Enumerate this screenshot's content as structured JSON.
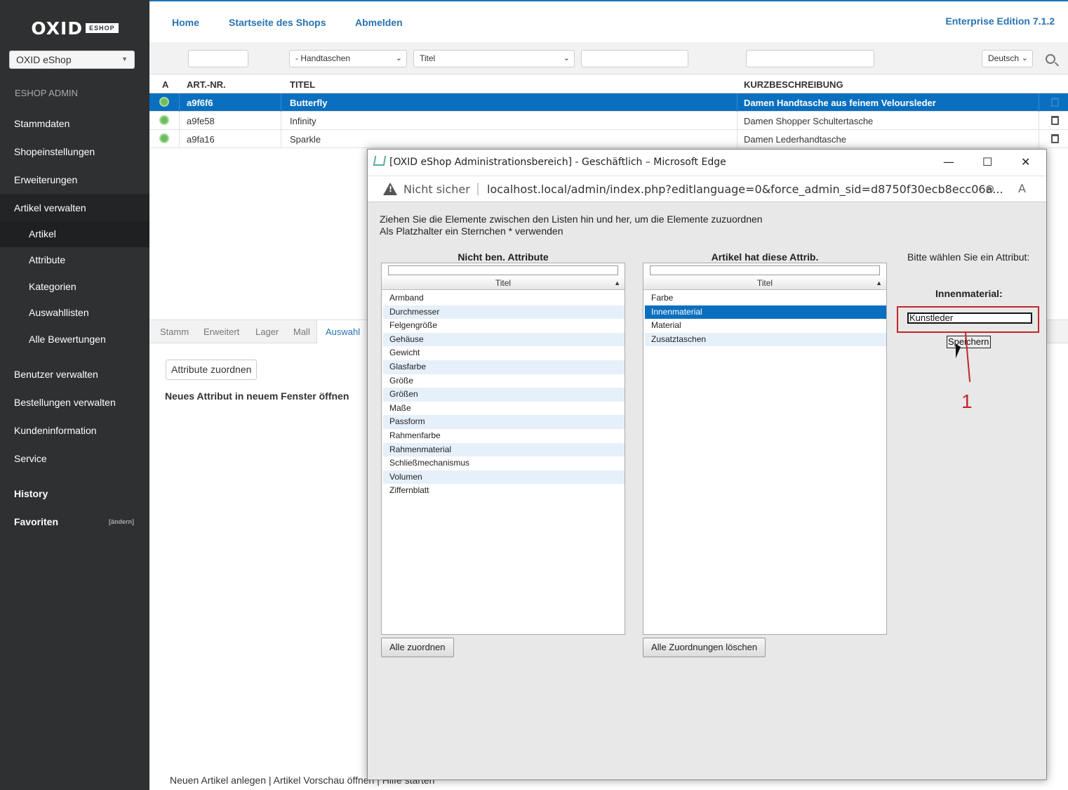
{
  "sidebar": {
    "logo": "OXID",
    "logo_tag": "ESHOP",
    "shop_select": "OXID eShop",
    "section": "ESHOP ADMIN",
    "items": [
      {
        "label": "Stammdaten"
      },
      {
        "label": "Shopeinstellungen"
      },
      {
        "label": "Erweiterungen"
      },
      {
        "label": "Artikel verwalten"
      }
    ],
    "subitems": [
      {
        "label": "Artikel"
      },
      {
        "label": "Attribute"
      },
      {
        "label": "Kategorien"
      },
      {
        "label": "Auswahllisten"
      },
      {
        "label": "Alle Bewertungen"
      }
    ],
    "items2": [
      {
        "label": "Benutzer verwalten"
      },
      {
        "label": "Bestellungen verwalten"
      },
      {
        "label": "Kundeninformation"
      },
      {
        "label": "Service"
      },
      {
        "label": "History"
      },
      {
        "label": "Favoriten"
      }
    ],
    "fav_change": "[ändern]"
  },
  "topbar": {
    "home": "Home",
    "shop_start": "Startseite des Shops",
    "logout": "Abmelden",
    "edition": "Enterprise Edition 7.1.2"
  },
  "filters": {
    "category": "- Handtaschen",
    "field": "Titel",
    "language": "Deutsch"
  },
  "table": {
    "headers": {
      "active": "A",
      "artnum": "ART.-NR.",
      "title": "TITEL",
      "short": "KURZBESCHREIBUNG"
    },
    "rows": [
      {
        "artnum": "a9f6f6",
        "title": "Butterfly",
        "short": "Damen Handtasche aus feinem Veloursleder"
      },
      {
        "artnum": "a9fe58",
        "title": "Infinity",
        "short": "Damen Shopper Schultertasche"
      },
      {
        "artnum": "a9fa16",
        "title": "Sparkle",
        "short": "Damen Lederhandtasche"
      }
    ]
  },
  "tabs": [
    "Stamm",
    "Erweitert",
    "Lager",
    "Mall",
    "Auswahl"
  ],
  "lower": {
    "assign_button": "Attribute zuordnen",
    "new_window_link": "Neues Attribut in neuem Fenster öffnen"
  },
  "footer": {
    "text": "Neuen Artikel anlegen  |  Artikel Vorschau öffnen  |  Hilfe starten"
  },
  "popup": {
    "title": "[OXID eShop Administrationsbereich] - Geschäftlich – Microsoft Edge",
    "not_secure": "Nicht sicher",
    "url": "localhost.local/admin/index.php?editlanguage=0&force_admin_sid=d8750f30ecb8ecc06a...",
    "instr_line1": "Ziehen Sie die Elemente zwischen den Listen hin und her, um die Elemente zuzuordnen",
    "instr_line2": "Als Platzhalter ein Sternchen * verwenden",
    "left_title": "Nicht ben. Attribute",
    "right_title": "Artikel hat diese Attrib.",
    "col_header": "Titel",
    "left_items": [
      "Armband",
      "Durchmesser",
      "Felgengröße",
      "Gehäuse",
      "Gewicht",
      "Glasfarbe",
      "Größe",
      "Größen",
      "Maße",
      "Passform",
      "Rahmenfarbe",
      "Rahmenmaterial",
      "Schließmechanismus",
      "Volumen",
      "Ziffernblatt"
    ],
    "right_items": [
      "Farbe",
      "Innenmaterial",
      "Material",
      "Zusatztaschen"
    ],
    "assign_all": "Alle zuordnen",
    "remove_all": "Alle Zuordnungen löschen",
    "choose_label": "Bitte wählen Sie ein Attribut:",
    "attr_name": "Innenmaterial:",
    "attr_value": "Kunstleder",
    "save": "Speichern",
    "callout": "1"
  }
}
